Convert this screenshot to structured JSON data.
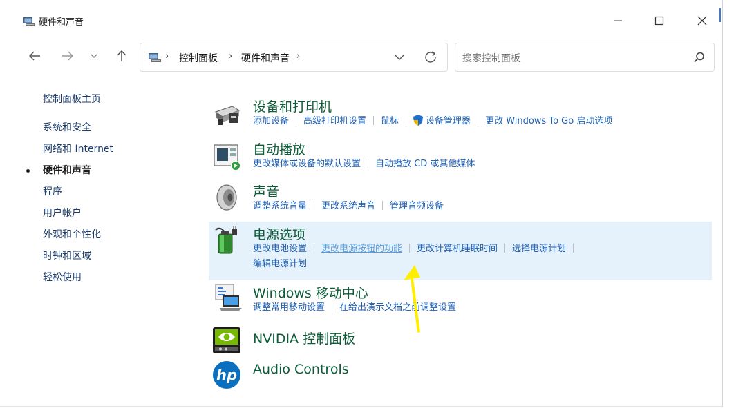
{
  "window": {
    "title": "硬件和声音",
    "controls": {
      "minimize": "—",
      "maximize": "☐",
      "close": "✕"
    }
  },
  "nav": {
    "back_icon": "arrow-left-icon",
    "forward_icon": "arrow-right-icon",
    "recent_icon": "chevron-down-icon",
    "up_icon": "arrow-up-icon"
  },
  "address": {
    "sep1": "›",
    "crumb1": "控制面板",
    "sep2": "›",
    "crumb2": "硬件和声音",
    "sep3": "›"
  },
  "search": {
    "placeholder": "搜索控制面板"
  },
  "sidebar": {
    "home": "控制面板主页",
    "items": [
      {
        "label": "系统和安全"
      },
      {
        "label": "网络和 Internet"
      },
      {
        "label": "硬件和声音",
        "active": true
      },
      {
        "label": "程序"
      },
      {
        "label": "用户帐户"
      },
      {
        "label": "外观和个性化"
      },
      {
        "label": "时钟和区域"
      },
      {
        "label": "轻松使用"
      }
    ]
  },
  "categories": [
    {
      "title": "设备和打印机",
      "icon": "printer-icon",
      "links": [
        "添加设备",
        "高级打印机设置",
        "鼠标",
        "设备管理器",
        "更改 Windows To Go 启动选项"
      ]
    },
    {
      "title": "自动播放",
      "icon": "autoplay-icon",
      "links": [
        "更改媒体或设备的默认设置",
        "自动播放 CD 或其他媒体"
      ]
    },
    {
      "title": "声音",
      "icon": "speaker-icon",
      "links": [
        "调整系统音量",
        "更改系统声音",
        "管理音频设备"
      ]
    },
    {
      "title": "电源选项",
      "icon": "battery-plug-icon",
      "links": [
        "更改电池设置",
        "更改电源按钮的功能",
        "更改计算机睡眠时间",
        "选择电源计划",
        "编辑电源计划"
      ]
    },
    {
      "title": "Windows 移动中心",
      "icon": "mobility-center-icon",
      "links": [
        "调整常用移动设置",
        "在给出演示文档之前调整设置"
      ]
    },
    {
      "title": "NVIDIA 控制面板",
      "icon": "nvidia-icon",
      "links": []
    },
    {
      "title": "Audio Controls",
      "icon": "hp-logo-icon",
      "links": []
    }
  ],
  "colors": {
    "category_title": "#0d5c39",
    "link": "#1e5fb4",
    "highlight": "#e5f1fb",
    "annotation_arrow": "#ffee00"
  }
}
